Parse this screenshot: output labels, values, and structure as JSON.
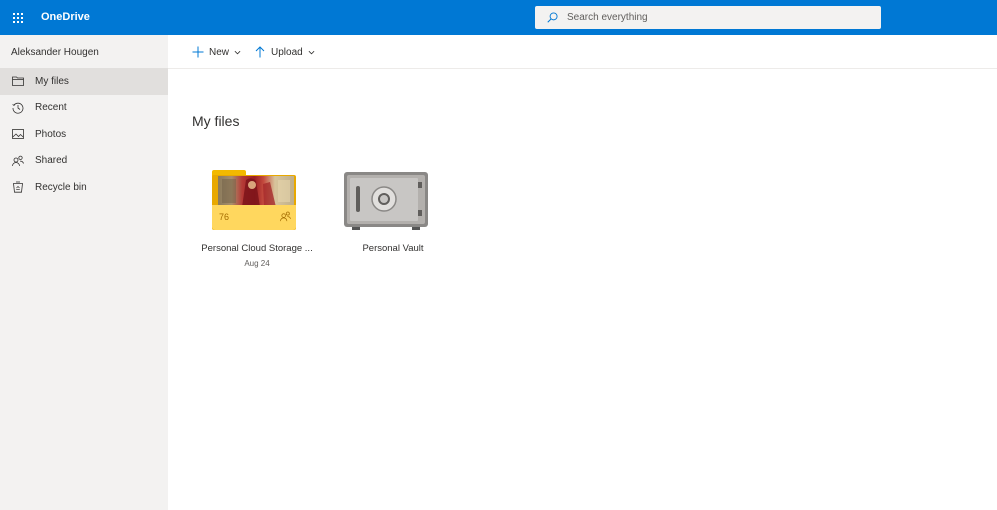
{
  "app": {
    "brand": "OneDrive"
  },
  "search": {
    "placeholder": "Search everything"
  },
  "sidebar": {
    "user_name": "Aleksander Hougen",
    "items": [
      {
        "label": "My files",
        "icon": "folder-icon",
        "active": true
      },
      {
        "label": "Recent",
        "icon": "clock-icon",
        "active": false
      },
      {
        "label": "Photos",
        "icon": "image-icon",
        "active": false
      },
      {
        "label": "Shared",
        "icon": "people-icon",
        "active": false
      },
      {
        "label": "Recycle bin",
        "icon": "recycle-bin-icon",
        "active": false
      }
    ]
  },
  "commandbar": {
    "new_label": "New",
    "upload_label": "Upload"
  },
  "main": {
    "title": "My files",
    "items": [
      {
        "name": "Personal Cloud Storage ...",
        "date": "Aug 24",
        "count": "76",
        "type": "shared-folder"
      },
      {
        "name": "Personal Vault",
        "date": "",
        "type": "vault"
      }
    ]
  },
  "colors": {
    "accent": "#0078d4",
    "sidebar_bg": "#f3f2f1",
    "folder": "#ffd75e"
  }
}
